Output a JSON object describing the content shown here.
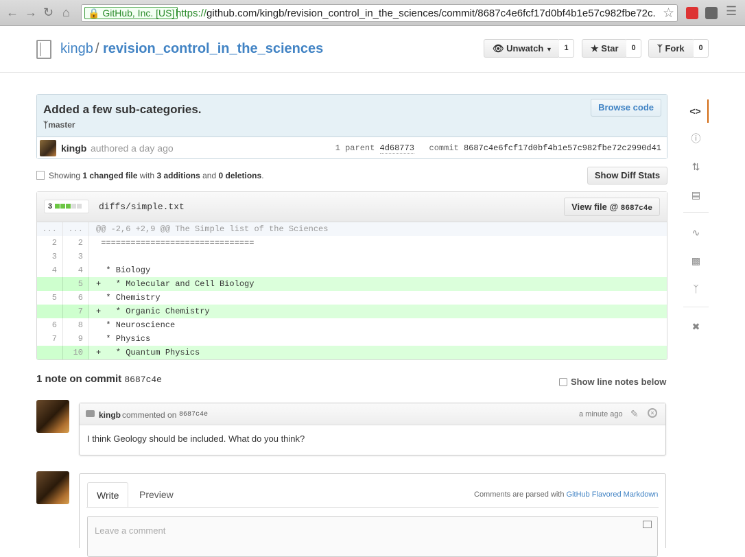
{
  "browser": {
    "ev_label": "GitHub, Inc. [US]",
    "url_scheme": "https://",
    "url_rest": "github.com/kingb/revision_control_in_the_sciences/commit/8687c4e6fcf17d0bf4b1e57c982fbe72c..."
  },
  "repo": {
    "owner": "kingb",
    "separator": "/",
    "name": "revision_control_in_the_sciences",
    "unwatch_label": "Unwatch",
    "watch_count": "1",
    "star_label": "Star",
    "star_count": "0",
    "fork_label": "Fork",
    "fork_count": "0"
  },
  "commit": {
    "title": "Added a few sub-categories.",
    "branch": "master",
    "browse_label": "Browse code",
    "author": "kingb",
    "authored": "authored a day ago",
    "parent_label": "1 parent",
    "parent_sha": "4d68773",
    "commit_label": "commit",
    "sha": "8687c4e6fcf17d0bf4b1e57c982fbe72c2990d41"
  },
  "toc": {
    "showing": "Showing",
    "changed": "1 changed file",
    "with": "with",
    "additions": "3 additions",
    "and": "and",
    "deletions": "0 deletions",
    "period": ".",
    "diff_stats_label": "Show Diff Stats"
  },
  "file": {
    "stat_count": "3",
    "name": "diffs/simple.txt",
    "view_label": "View file @",
    "view_sha": "8687c4e",
    "lines": [
      {
        "type": "hunk",
        "old": "...",
        "new": "...",
        "code": "@@ -2,6 +2,9 @@ The Simple list of the Sciences"
      },
      {
        "type": "ctx",
        "old": "2",
        "new": "2",
        "code": " ==============================="
      },
      {
        "type": "ctx",
        "old": "3",
        "new": "3",
        "code": " "
      },
      {
        "type": "ctx",
        "old": "4",
        "new": "4",
        "code": "  * Biology"
      },
      {
        "type": "add",
        "old": "",
        "new": "5",
        "code": "+   * Molecular and Cell Biology"
      },
      {
        "type": "ctx",
        "old": "5",
        "new": "6",
        "code": "  * Chemistry"
      },
      {
        "type": "add",
        "old": "",
        "new": "7",
        "code": "+   * Organic Chemistry"
      },
      {
        "type": "ctx",
        "old": "6",
        "new": "8",
        "code": "  * Neuroscience"
      },
      {
        "type": "ctx",
        "old": "7",
        "new": "9",
        "code": "  * Physics"
      },
      {
        "type": "add",
        "old": "",
        "new": "10",
        "code": "+   * Quantum Physics"
      }
    ]
  },
  "notes": {
    "heading": "1 note on commit",
    "heading_sha": "8687c4e",
    "show_line_notes": "Show line notes below"
  },
  "comment": {
    "user": "kingb",
    "commented_on": "commented on",
    "sha": "8687c4e",
    "time": "a minute ago",
    "body": "I think Geology should be included. What do you think?"
  },
  "new_comment": {
    "write_tab": "Write",
    "preview_tab": "Preview",
    "parsed_with": "Comments are parsed with",
    "gfm_link": "GitHub Flavored Markdown",
    "placeholder": "Leave a comment"
  }
}
